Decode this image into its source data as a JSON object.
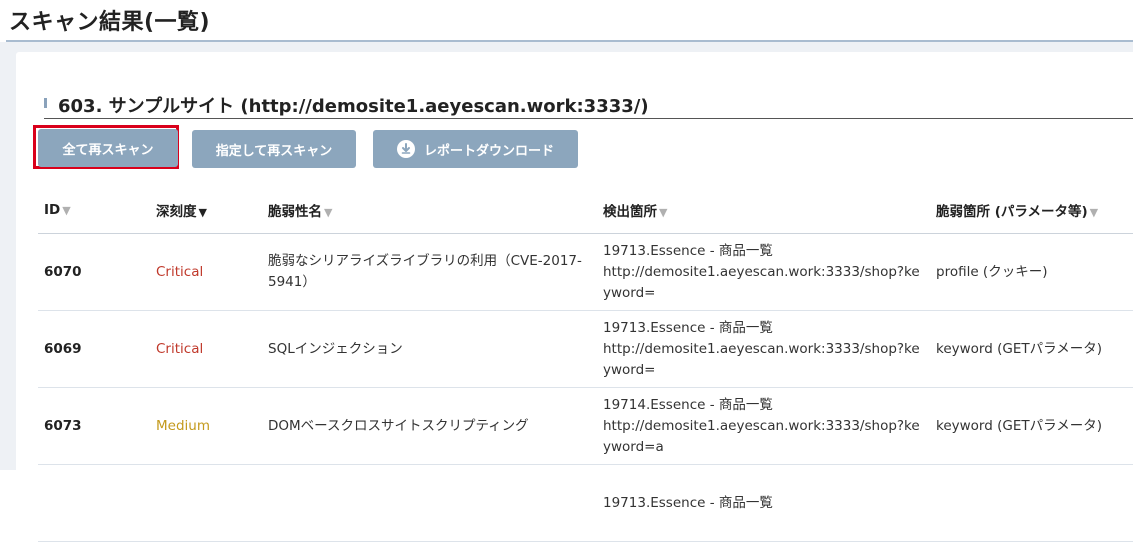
{
  "page": {
    "title": "スキャン結果(一覧)"
  },
  "site": {
    "title": "603. サンプルサイト (http://demosite1.aeyescan.work:3333/)"
  },
  "buttons": {
    "rescan_all": "全て再スキャン",
    "rescan_selected": "指定して再スキャン",
    "report_download": "レポートダウンロード"
  },
  "colors": {
    "button_bg": "#8ca6bd",
    "highlight_frame": "#d9001b",
    "critical": "#c0392b",
    "medium": "#c49a1d"
  },
  "table": {
    "headers": [
      "ID",
      "深刻度",
      "脆弱性名",
      "検出箇所",
      "脆弱箇所 (パラメータ等)"
    ],
    "sort_icon": "▼",
    "active_sort_column": "深刻度",
    "rows": [
      {
        "id": "6070",
        "severity": "Critical",
        "name": "脆弱なシリアライズライブラリの利用（CVE-2017-5941）",
        "location_page": "19713.Essence - 商品一覧",
        "location_url": "http://demosite1.aeyescan.work:3333/shop?keyword=",
        "parameter": "profile (クッキー)"
      },
      {
        "id": "6069",
        "severity": "Critical",
        "name": "SQLインジェクション",
        "location_page": "19713.Essence - 商品一覧",
        "location_url": "http://demosite1.aeyescan.work:3333/shop?keyword=",
        "parameter": "keyword (GETパラメータ)"
      },
      {
        "id": "6073",
        "severity": "Medium",
        "name": "DOMベースクロスサイトスクリプティング",
        "location_page": "19714.Essence - 商品一覧",
        "location_url": "http://demosite1.aeyescan.work:3333/shop?keyword=a",
        "parameter": "keyword (GETパラメータ)"
      },
      {
        "id": "",
        "severity": "",
        "name": "",
        "location_page": "19713.Essence - 商品一覧",
        "location_url": "",
        "parameter": ""
      }
    ]
  }
}
